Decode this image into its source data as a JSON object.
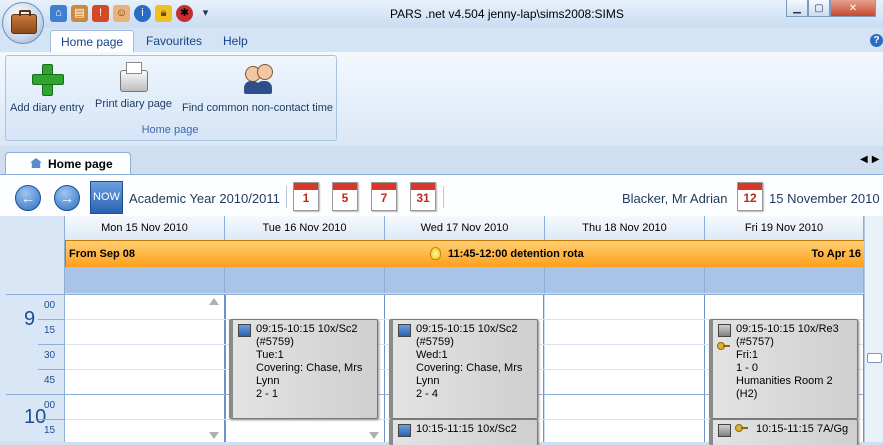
{
  "window": {
    "title": "PARS .net v4.504  jenny-lap\\sims2008:SIMS"
  },
  "ribbon": {
    "tabs": [
      {
        "label": "Home page",
        "active": true
      },
      {
        "label": "Favourites",
        "active": false
      },
      {
        "label": "Help",
        "active": false
      }
    ],
    "group_label": "Home page",
    "buttons": [
      {
        "label": "Add diary entry",
        "icon": "add-icon"
      },
      {
        "label": "Print diary page",
        "icon": "printer-icon"
      },
      {
        "label": "Find common non-contact time",
        "icon": "people-icon"
      }
    ]
  },
  "doc_tab": {
    "label": "Home page"
  },
  "toolbar": {
    "now_label": "NOW",
    "academic_year": "Academic Year 2010/2011",
    "calendar_buttons": [
      "1",
      "5",
      "7",
      "31",
      "12"
    ],
    "user": "Blacker, Mr Adrian",
    "date": "15 November 2010"
  },
  "days": [
    "Mon 15 Nov 2010",
    "Tue 16 Nov 2010",
    "Wed 17 Nov 2010",
    "Thu 18 Nov 2010",
    "Fri 19 Nov 2010"
  ],
  "banner": {
    "left": "From Sep 08",
    "middle": "11:45-12:00 detention rota",
    "right": "To Apr 16"
  },
  "time_gutter": {
    "hour1": "9",
    "hour2": "10",
    "minutes": [
      "00",
      "15",
      "30",
      "45",
      "00",
      "15"
    ]
  },
  "events": [
    {
      "lines": [
        "09:15-10:15  10x/Sc2",
        "(#5759)",
        "Tue:1",
        "Covering: Chase, Mrs",
        "Lynn",
        "2 - 1"
      ]
    },
    {
      "lines": [
        "09:15-10:15  10x/Sc2",
        "(#5759)",
        "Wed:1",
        "Covering: Chase, Mrs",
        "Lynn",
        "2 - 4"
      ]
    },
    {
      "lines": [
        "09:15-10:15  10x/Re3",
        "(#5757)",
        "Fri:1",
        "1 - 0",
        "Humanities Room 2",
        "(H2)"
      ]
    },
    {
      "lines": [
        "10:15-11:15  10x/Sc2"
      ]
    },
    {
      "lines": [
        "10:15-11:15  7A/Gg"
      ]
    }
  ],
  "colors": {
    "accent": "#2a62b0",
    "banner": "#ff9f1c",
    "event_bg": "#d6d6d6"
  }
}
